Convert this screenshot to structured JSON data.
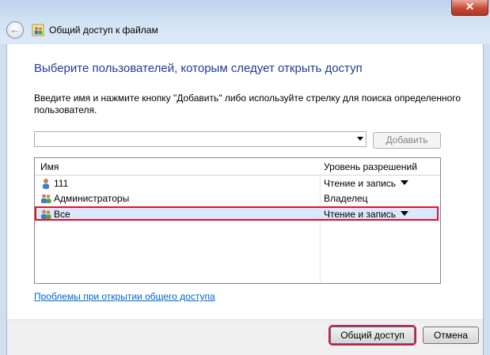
{
  "window": {
    "title": "Общий доступ к файлам",
    "close_label": "✕"
  },
  "main": {
    "heading": "Выберите пользователей, которым следует открыть доступ",
    "instruction": "Введите имя и нажмите кнопку \"Добавить\" либо используйте стрелку для поиска определенного пользователя.",
    "user_input": {
      "value": "",
      "placeholder": ""
    },
    "add_button": "Добавить",
    "table": {
      "headers": {
        "name": "Имя",
        "permission": "Уровень разрешений"
      },
      "rows": [
        {
          "name": "111",
          "permission": "Чтение и запись",
          "icon": "user-icon",
          "has_dropdown": true,
          "selected": false
        },
        {
          "name": "Администраторы",
          "permission": "Владелец",
          "icon": "user-group-icon",
          "has_dropdown": false,
          "selected": false
        },
        {
          "name": "Все",
          "permission": "Чтение и запись",
          "icon": "user-group-icon",
          "has_dropdown": true,
          "selected": true
        }
      ]
    },
    "help_link": "Проблемы при открытии общего доступа"
  },
  "footer": {
    "share_button": "Общий доступ",
    "cancel_button": "Отмена"
  },
  "colors": {
    "heading": "#1e3d8c",
    "link": "#0066cc",
    "highlight": "#d9182b",
    "selection": "#d9e8fb"
  }
}
